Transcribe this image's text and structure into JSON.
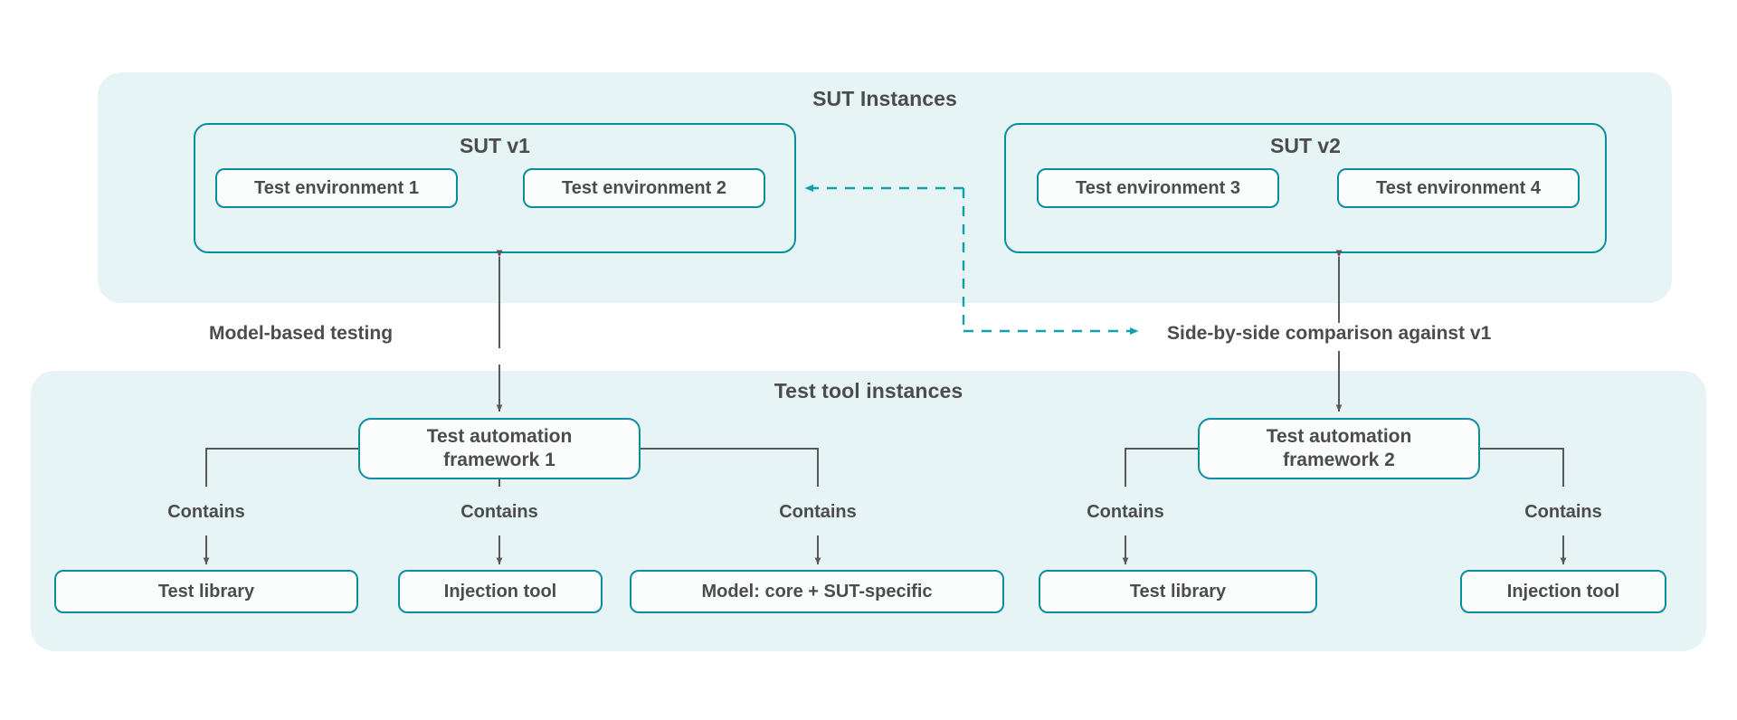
{
  "diagram": {
    "title_visible": false,
    "colors": {
      "panel_background": "#e6f4f5",
      "node_border": "#0b8f9e",
      "node_fill": "#fbfdfd",
      "text": "#4c4c4c",
      "solid_connector": "#595959",
      "dashed_connector": "#13a0ad",
      "page_background": "#ffffff"
    }
  },
  "panels": [
    {
      "id": "sut-instances",
      "title": "SUT Instances"
    },
    {
      "id": "test-tool-instances",
      "title": "Test tool instances"
    }
  ],
  "sut_groups": [
    {
      "id": "sut-v1",
      "title": "SUT v1",
      "environments": [
        {
          "label": "Test environment 1"
        },
        {
          "label": "Test environment 2"
        }
      ]
    },
    {
      "id": "sut-v2",
      "title": "SUT v2",
      "environments": [
        {
          "label": "Test environment 3"
        },
        {
          "label": "Test environment 4"
        }
      ]
    }
  ],
  "frameworks": [
    {
      "id": "framework-1",
      "label": "Test automation framework 1",
      "line1": "Test automation",
      "line2": "framework 1",
      "children": [
        {
          "label": "Test library",
          "relation": "Contains"
        },
        {
          "label": "Injection tool",
          "relation": "Contains"
        },
        {
          "label": "Model: core + SUT-specific",
          "relation": "Contains"
        }
      ]
    },
    {
      "id": "framework-2",
      "label": "Test automation framework 2",
      "line1": "Test automation",
      "line2": "framework 2",
      "children": [
        {
          "label": "Test library",
          "relation": "Contains"
        },
        {
          "label": "Injection tool",
          "relation": "Contains"
        }
      ]
    }
  ],
  "edges": [
    {
      "id": "model-based-testing",
      "label": "Model-based testing",
      "style": "solid",
      "arrowheads": "both",
      "from": "framework-1",
      "to": "sut-v1"
    },
    {
      "id": "side-by-side-comparison",
      "label": "Side-by-side comparison against v1",
      "style": "solid",
      "arrowheads": "both",
      "from": "framework-2",
      "to": "sut-v2"
    },
    {
      "id": "v2-to-v1-dashed",
      "label": "",
      "style": "dashed",
      "arrowheads": "both-ends",
      "from": "sut-v2",
      "to": "sut-v1"
    }
  ],
  "contains_labels": [
    {
      "text": "Contains"
    },
    {
      "text": "Contains"
    },
    {
      "text": "Contains"
    },
    {
      "text": "Contains"
    },
    {
      "text": "Contains"
    }
  ]
}
